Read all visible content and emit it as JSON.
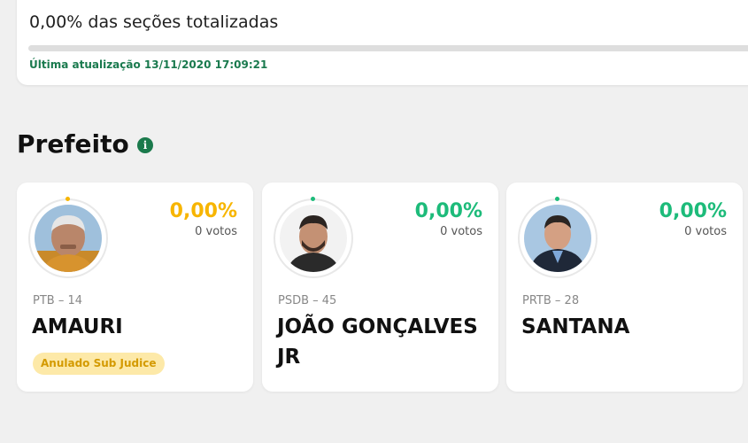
{
  "status": {
    "sections_totalized": "0,00% das seções totalizadas",
    "progress_fraction": 0.0,
    "last_update": "Última atualização 13/11/2020 17:09:21"
  },
  "section": {
    "title": "Prefeito",
    "info_icon": "info-icon"
  },
  "colors": {
    "yellow": "#f7b500",
    "green": "#1dbb7a",
    "brand_green": "#1b7a4c"
  },
  "candidates": [
    {
      "percentage": "0,00%",
      "votes": "0 votos",
      "party": "PTB – 14",
      "name": "AMAURI",
      "badge": "Anulado Sub Judice",
      "accent": "#f7b500"
    },
    {
      "percentage": "0,00%",
      "votes": "0 votos",
      "party": "PSDB – 45",
      "name": "JOÃO GONÇALVES JR",
      "badge": "",
      "accent": "#1dbb7a"
    },
    {
      "percentage": "0,00%",
      "votes": "0 votos",
      "party": "PRTB – 28",
      "name": "SANTANA",
      "badge": "",
      "accent": "#1dbb7a"
    }
  ]
}
